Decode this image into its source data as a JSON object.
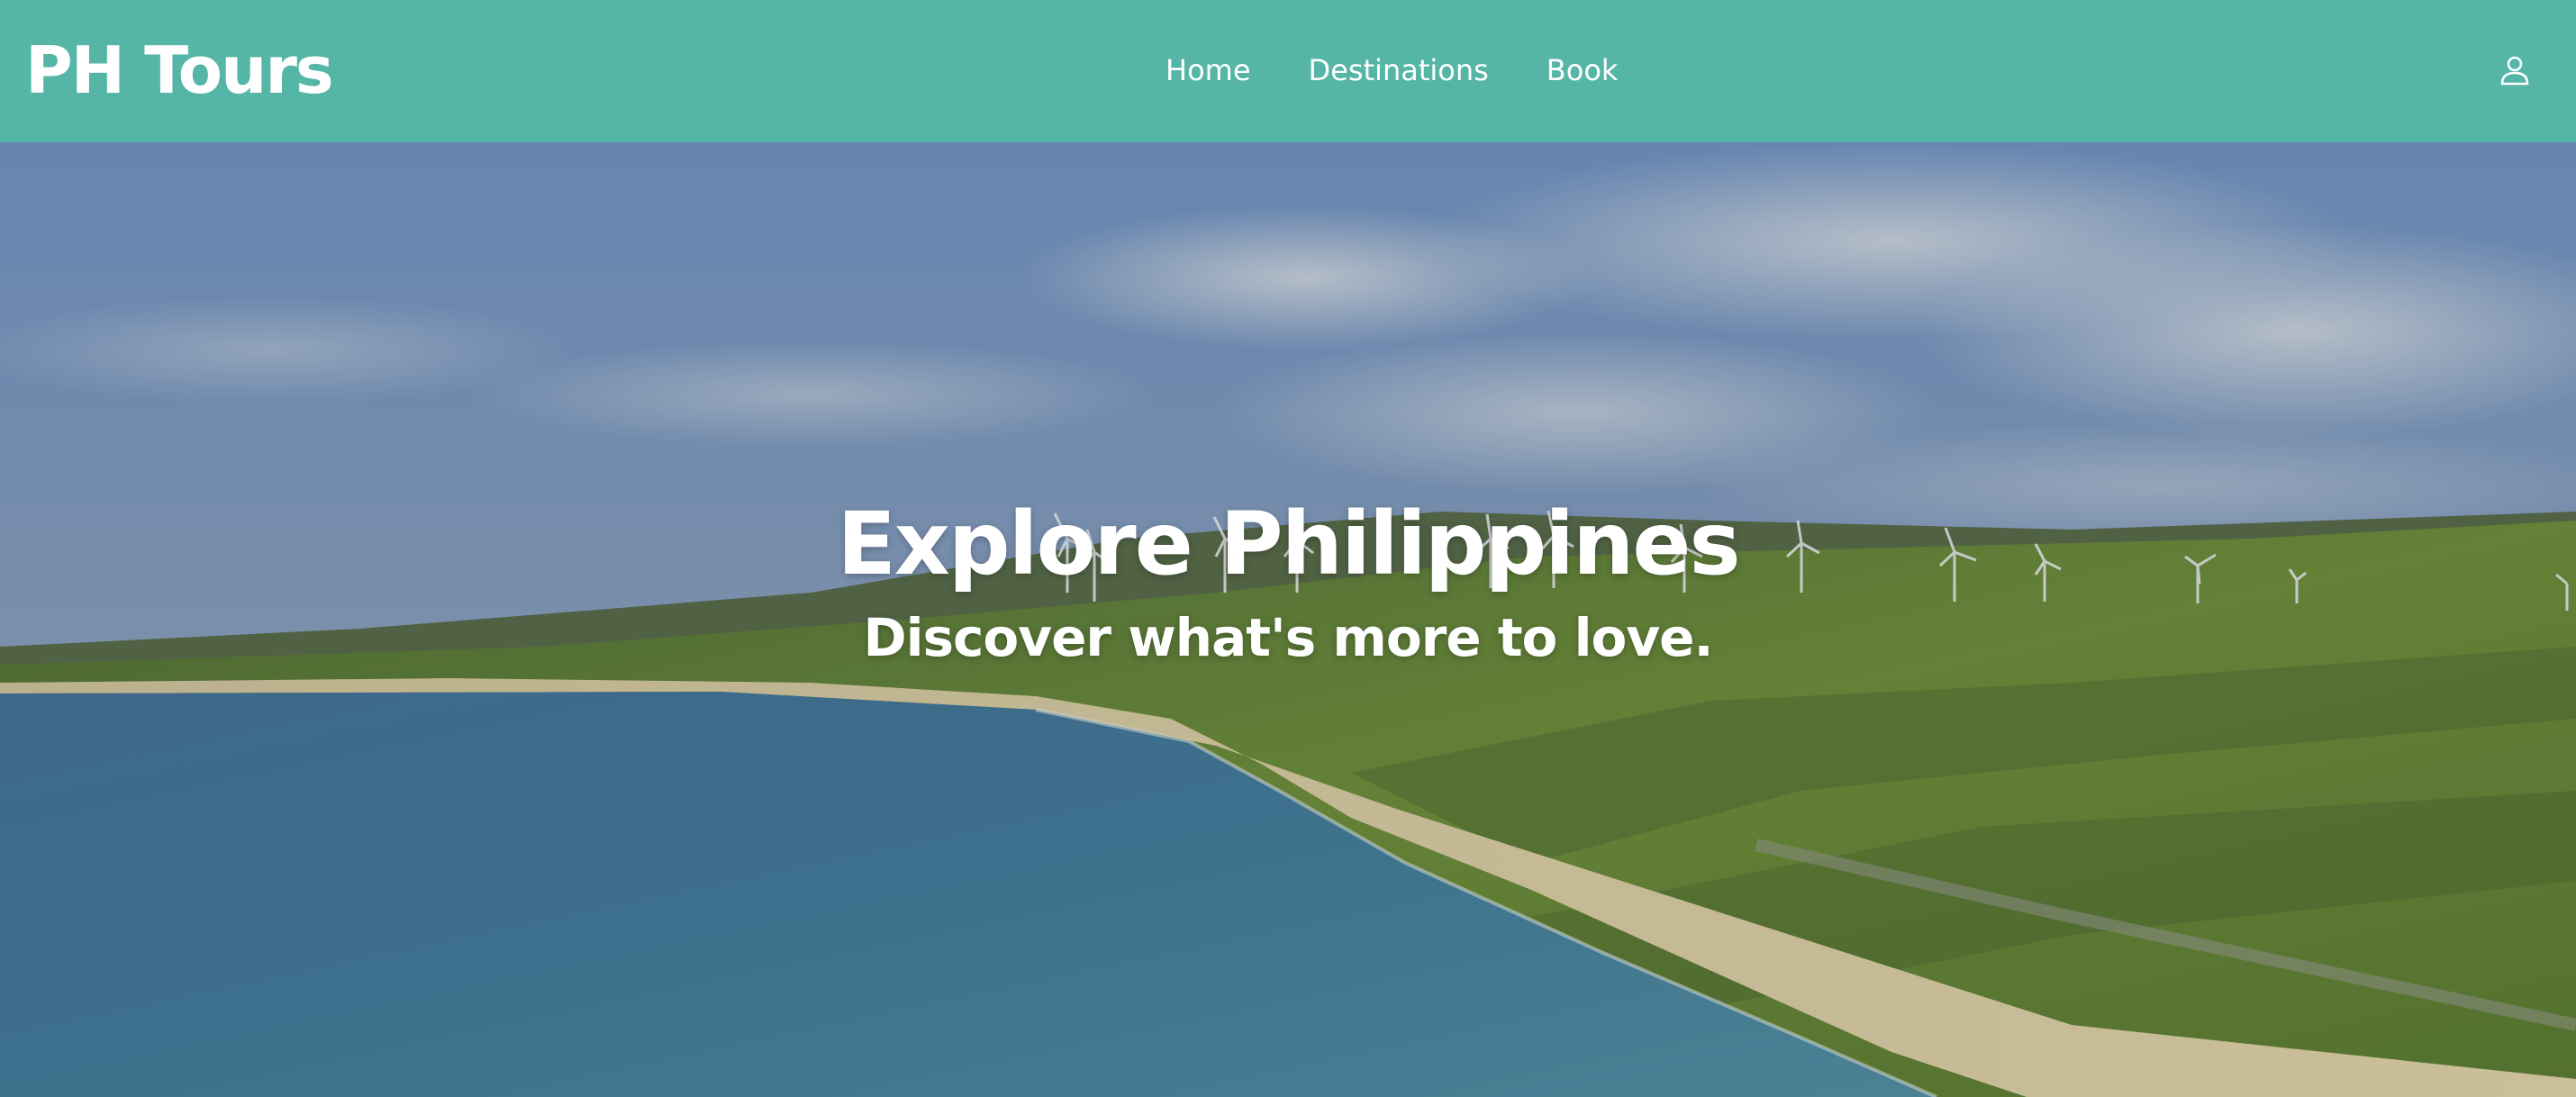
{
  "navbar": {
    "brand": "PH Tours",
    "links": [
      {
        "label": "Home"
      },
      {
        "label": "Destinations"
      },
      {
        "label": "Book"
      }
    ],
    "user_icon": "user-icon",
    "background_color": "#55b5a6"
  },
  "hero": {
    "title": "Explore Philippines",
    "subtitle": "Discover what's more to love.",
    "background_image": "aerial beach coastline with wind turbines"
  }
}
